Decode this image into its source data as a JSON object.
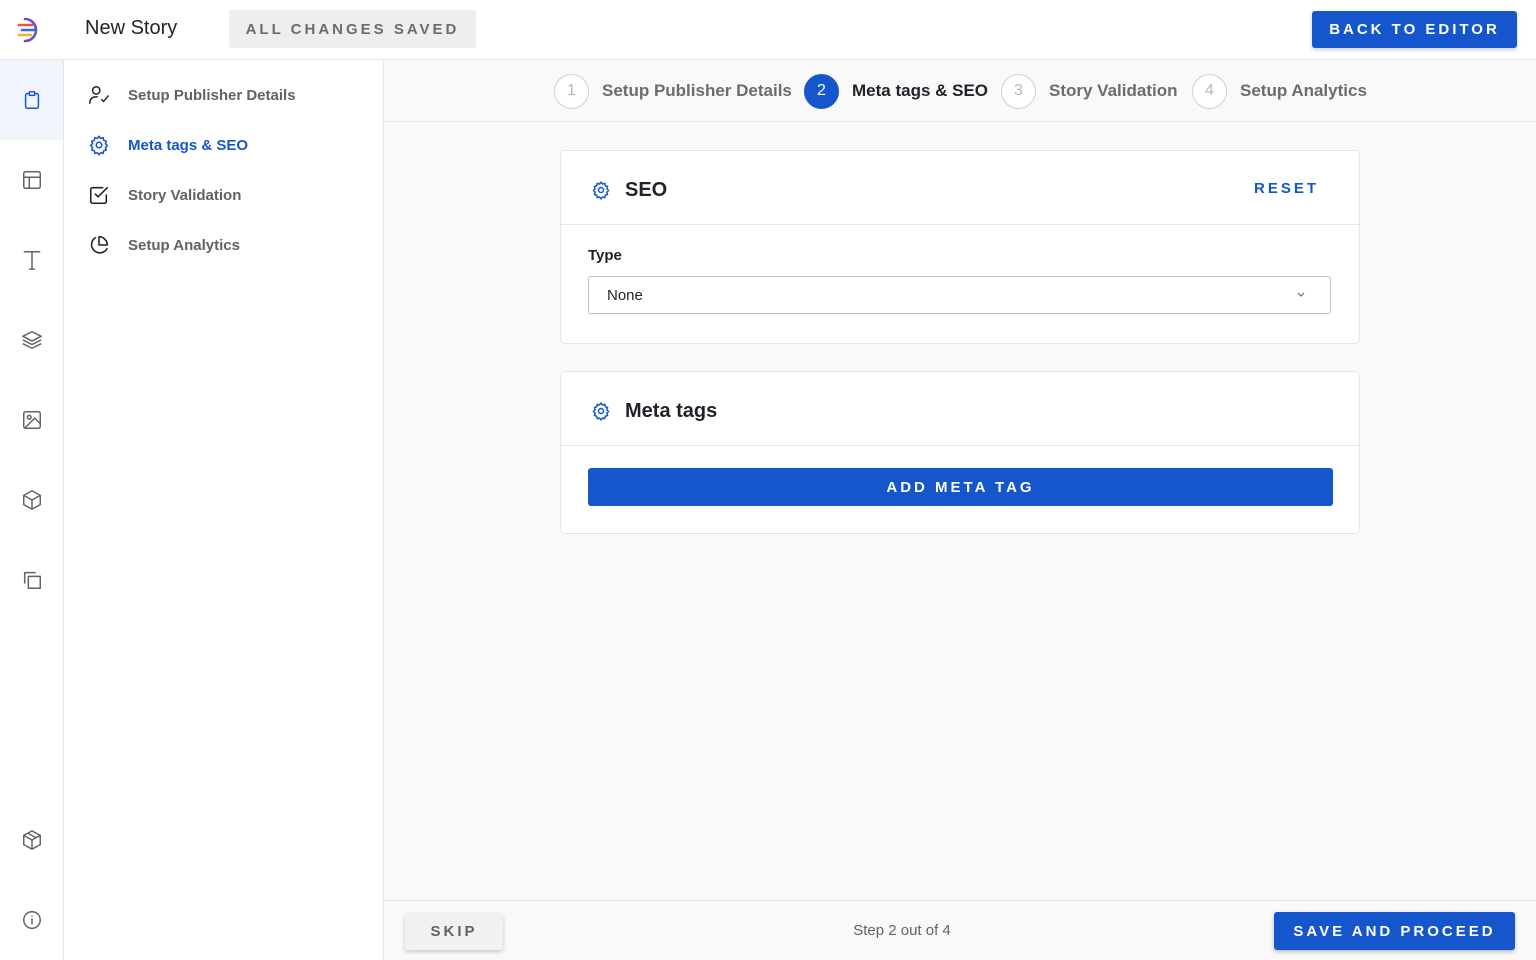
{
  "header": {
    "story_title": "New Story",
    "save_status": "ALL CHANGES SAVED",
    "back_button": "BACK TO EDITOR"
  },
  "rail": {
    "items": [
      {
        "icon": "clipboard-icon",
        "active": true
      },
      {
        "icon": "layout-icon",
        "active": false
      },
      {
        "icon": "text-icon",
        "active": false
      },
      {
        "icon": "layers-icon",
        "active": false
      },
      {
        "icon": "image-icon",
        "active": false
      },
      {
        "icon": "cube-icon",
        "active": false
      },
      {
        "icon": "copy-icon",
        "active": false
      },
      {
        "icon": "package-icon",
        "active": false
      },
      {
        "icon": "info-icon",
        "active": false
      }
    ]
  },
  "sidebar": {
    "items": [
      {
        "label": "Setup Publisher Details",
        "icon": "user-check-icon",
        "active": false
      },
      {
        "label": "Meta tags & SEO",
        "icon": "gear-icon",
        "active": true
      },
      {
        "label": "Story Validation",
        "icon": "checkbox-icon",
        "active": false
      },
      {
        "label": "Setup Analytics",
        "icon": "pie-chart-icon",
        "active": false
      }
    ]
  },
  "stepper": {
    "steps": [
      {
        "number": "1",
        "label": "Setup Publisher Details",
        "active": false
      },
      {
        "number": "2",
        "label": "Meta tags & SEO",
        "active": true
      },
      {
        "number": "3",
        "label": "Story Validation",
        "active": false
      },
      {
        "number": "4",
        "label": "Setup Analytics",
        "active": false
      }
    ]
  },
  "seo_card": {
    "title": "SEO",
    "reset_label": "RESET",
    "type_label": "Type",
    "type_value": "None"
  },
  "meta_card": {
    "title": "Meta tags",
    "add_label": "ADD META TAG"
  },
  "footer": {
    "skip_label": "SKIP",
    "step_text": "Step 2 out of 4",
    "save_label": "SAVE AND PROCEED"
  },
  "colors": {
    "accent": "#1656cc",
    "background": "#f9f9f9"
  }
}
